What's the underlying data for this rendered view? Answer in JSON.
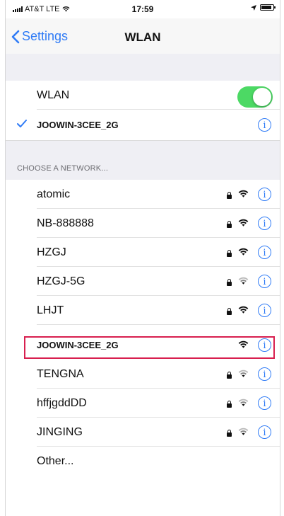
{
  "status_bar": {
    "carrier": "AT&T LTE",
    "time": "17:59"
  },
  "nav": {
    "back_label": "Settings",
    "title": "WLAN"
  },
  "wlan_row": {
    "label": "WLAN",
    "enabled": true
  },
  "connected_network": {
    "name": "JOOWIN-3CEE_2G"
  },
  "section_header": "CHOOSE A NETWORK...",
  "networks": [
    {
      "name": "atomic",
      "locked": true
    },
    {
      "name": "NB-888888",
      "locked": true
    },
    {
      "name": "HZGJ",
      "locked": true
    },
    {
      "name": "HZGJ-5G",
      "locked": true
    },
    {
      "name": "LHJT",
      "locked": true
    },
    {
      "name": "JOOWIN-3CEE_2G",
      "locked": false,
      "highlighted": true
    },
    {
      "name": "TENGNA",
      "locked": true
    },
    {
      "name": "hffjgddDD",
      "locked": true
    },
    {
      "name": "JINGING",
      "locked": true
    }
  ],
  "other_label": "Other...",
  "info_glyph": "i",
  "colors": {
    "accent": "#2f7bf6",
    "toggle_on": "#4cd964",
    "highlight": "#d81f4f"
  }
}
